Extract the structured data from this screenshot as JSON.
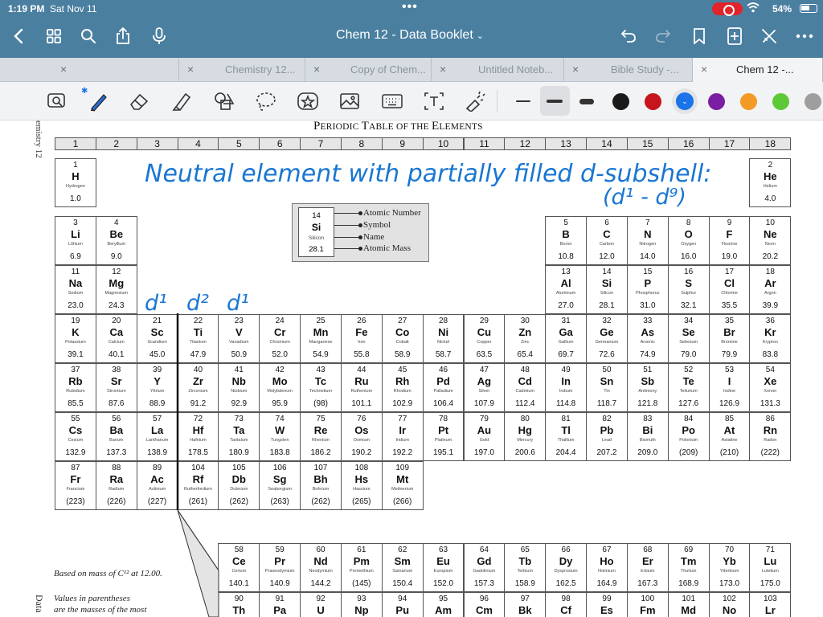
{
  "status": {
    "time": "1:19 PM",
    "date": "Sat Nov 11",
    "battery": "54%"
  },
  "header": {
    "title": "Chem 12 - Data Booklet"
  },
  "tabs": [
    {
      "label": "",
      "active": false
    },
    {
      "label": "Chemistry 12...",
      "active": false
    },
    {
      "label": "Copy of Chem...",
      "active": false
    },
    {
      "label": "Untitled Noteb...",
      "active": false
    },
    {
      "label": "Bible Study -...",
      "active": false
    },
    {
      "label": "Chem 12 -...",
      "active": true
    }
  ],
  "toolbar": {
    "tools": [
      "lasso-zoom-icon",
      "pen-icon",
      "eraser-icon",
      "highlighter-icon",
      "shapes-icon",
      "lasso-icon",
      "sticker-icon",
      "image-icon",
      "keyboard-icon",
      "text-icon",
      "laser-pointer-icon"
    ],
    "colors": [
      "#1a1a1a",
      "#c8141c",
      "#1a73e8",
      "#7b1fa2",
      "#f39a26",
      "#5ec936",
      "#9e9e9e"
    ],
    "selected_color": "#1a73e8"
  },
  "page": {
    "side_top": "emistry 12",
    "side_bottom": "Data",
    "title_first": "P",
    "title_rest": "ERIODIC ",
    "title_t": "T",
    "title_able": "ABLE OF THE ",
    "title_e": "E",
    "title_lements": "LEMENTS",
    "footnote_1": "Based on mass of C¹² at 12.00.",
    "footnote_2": "Values in parentheses",
    "footnote_3": "are the masses of the most"
  },
  "groups": [
    "1",
    "2",
    "3",
    "4",
    "5",
    "6",
    "7",
    "8",
    "9",
    "10",
    "11",
    "12",
    "13",
    "14",
    "15",
    "16",
    "17",
    "18"
  ],
  "key": {
    "n": "14",
    "s": "Si",
    "nm": "Silicon",
    "m": "28.1",
    "labels": [
      "Atomic Number",
      "Symbol",
      "Name",
      "Atomic Mass"
    ]
  },
  "ink": {
    "line1": "Neutral element with partially filled d-subshell:",
    "line2": "(d¹ - d⁹)",
    "d1a": "d¹",
    "d2": "d²",
    "d1b": "d¹"
  },
  "elements": [
    {
      "n": "1",
      "s": "H",
      "nm": "Hydrogen",
      "m": "1.0",
      "r": 0,
      "c": 0
    },
    {
      "n": "2",
      "s": "He",
      "nm": "Helium",
      "m": "4.0",
      "r": 0,
      "c": 17
    },
    {
      "n": "3",
      "s": "Li",
      "nm": "Lithium",
      "m": "6.9",
      "r": 1,
      "c": 0
    },
    {
      "n": "4",
      "s": "Be",
      "nm": "Beryllium",
      "m": "9.0",
      "r": 1,
      "c": 1
    },
    {
      "n": "5",
      "s": "B",
      "nm": "Boron",
      "m": "10.8",
      "r": 1,
      "c": 12
    },
    {
      "n": "6",
      "s": "C",
      "nm": "Carbon",
      "m": "12.0",
      "r": 1,
      "c": 13
    },
    {
      "n": "7",
      "s": "N",
      "nm": "Nitrogen",
      "m": "14.0",
      "r": 1,
      "c": 14
    },
    {
      "n": "8",
      "s": "O",
      "nm": "Oxygen",
      "m": "16.0",
      "r": 1,
      "c": 15
    },
    {
      "n": "9",
      "s": "F",
      "nm": "Fluorine",
      "m": "19.0",
      "r": 1,
      "c": 16
    },
    {
      "n": "10",
      "s": "Ne",
      "nm": "Neon",
      "m": "20.2",
      "r": 1,
      "c": 17
    },
    {
      "n": "11",
      "s": "Na",
      "nm": "Sodium",
      "m": "23.0",
      "r": 2,
      "c": 0
    },
    {
      "n": "12",
      "s": "Mg",
      "nm": "Magnesium",
      "m": "24.3",
      "r": 2,
      "c": 1
    },
    {
      "n": "13",
      "s": "Al",
      "nm": "Aluminum",
      "m": "27.0",
      "r": 2,
      "c": 12
    },
    {
      "n": "14",
      "s": "Si",
      "nm": "Silicon",
      "m": "28.1",
      "r": 2,
      "c": 13
    },
    {
      "n": "15",
      "s": "P",
      "nm": "Phosphorus",
      "m": "31.0",
      "r": 2,
      "c": 14
    },
    {
      "n": "16",
      "s": "S",
      "nm": "Sulphur",
      "m": "32.1",
      "r": 2,
      "c": 15
    },
    {
      "n": "17",
      "s": "Cl",
      "nm": "Chlorine",
      "m": "35.5",
      "r": 2,
      "c": 16
    },
    {
      "n": "18",
      "s": "Ar",
      "nm": "Argon",
      "m": "39.9",
      "r": 2,
      "c": 17
    },
    {
      "n": "19",
      "s": "K",
      "nm": "Potassium",
      "m": "39.1",
      "r": 3,
      "c": 0
    },
    {
      "n": "20",
      "s": "Ca",
      "nm": "Calcium",
      "m": "40.1",
      "r": 3,
      "c": 1
    },
    {
      "n": "21",
      "s": "Sc",
      "nm": "Scandium",
      "m": "45.0",
      "r": 3,
      "c": 2
    },
    {
      "n": "22",
      "s": "Ti",
      "nm": "Titanium",
      "m": "47.9",
      "r": 3,
      "c": 3
    },
    {
      "n": "23",
      "s": "V",
      "nm": "Vanadium",
      "m": "50.9",
      "r": 3,
      "c": 4
    },
    {
      "n": "24",
      "s": "Cr",
      "nm": "Chromium",
      "m": "52.0",
      "r": 3,
      "c": 5
    },
    {
      "n": "25",
      "s": "Mn",
      "nm": "Manganese",
      "m": "54.9",
      "r": 3,
      "c": 6
    },
    {
      "n": "26",
      "s": "Fe",
      "nm": "Iron",
      "m": "55.8",
      "r": 3,
      "c": 7
    },
    {
      "n": "27",
      "s": "Co",
      "nm": "Cobalt",
      "m": "58.9",
      "r": 3,
      "c": 8
    },
    {
      "n": "28",
      "s": "Ni",
      "nm": "Nickel",
      "m": "58.7",
      "r": 3,
      "c": 9
    },
    {
      "n": "29",
      "s": "Cu",
      "nm": "Copper",
      "m": "63.5",
      "r": 3,
      "c": 10
    },
    {
      "n": "30",
      "s": "Zn",
      "nm": "Zinc",
      "m": "65.4",
      "r": 3,
      "c": 11
    },
    {
      "n": "31",
      "s": "Ga",
      "nm": "Gallium",
      "m": "69.7",
      "r": 3,
      "c": 12
    },
    {
      "n": "32",
      "s": "Ge",
      "nm": "Germanium",
      "m": "72.6",
      "r": 3,
      "c": 13
    },
    {
      "n": "33",
      "s": "As",
      "nm": "Arsenic",
      "m": "74.9",
      "r": 3,
      "c": 14
    },
    {
      "n": "34",
      "s": "Se",
      "nm": "Selenium",
      "m": "79.0",
      "r": 3,
      "c": 15
    },
    {
      "n": "35",
      "s": "Br",
      "nm": "Bromine",
      "m": "79.9",
      "r": 3,
      "c": 16
    },
    {
      "n": "36",
      "s": "Kr",
      "nm": "Krypton",
      "m": "83.8",
      "r": 3,
      "c": 17
    },
    {
      "n": "37",
      "s": "Rb",
      "nm": "Rubidium",
      "m": "85.5",
      "r": 4,
      "c": 0
    },
    {
      "n": "38",
      "s": "Sr",
      "nm": "Strontium",
      "m": "87.6",
      "r": 4,
      "c": 1
    },
    {
      "n": "39",
      "s": "Y",
      "nm": "Yttrium",
      "m": "88.9",
      "r": 4,
      "c": 2
    },
    {
      "n": "40",
      "s": "Zr",
      "nm": "Zirconium",
      "m": "91.2",
      "r": 4,
      "c": 3
    },
    {
      "n": "41",
      "s": "Nb",
      "nm": "Niobium",
      "m": "92.9",
      "r": 4,
      "c": 4
    },
    {
      "n": "42",
      "s": "Mo",
      "nm": "Molybdenum",
      "m": "95.9",
      "r": 4,
      "c": 5
    },
    {
      "n": "43",
      "s": "Tc",
      "nm": "Technetium",
      "m": "(98)",
      "r": 4,
      "c": 6
    },
    {
      "n": "44",
      "s": "Ru",
      "nm": "Ruthenium",
      "m": "101.1",
      "r": 4,
      "c": 7
    },
    {
      "n": "45",
      "s": "Rh",
      "nm": "Rhodium",
      "m": "102.9",
      "r": 4,
      "c": 8
    },
    {
      "n": "46",
      "s": "Pd",
      "nm": "Palladium",
      "m": "106.4",
      "r": 4,
      "c": 9
    },
    {
      "n": "47",
      "s": "Ag",
      "nm": "Silver",
      "m": "107.9",
      "r": 4,
      "c": 10
    },
    {
      "n": "48",
      "s": "Cd",
      "nm": "Cadmium",
      "m": "112.4",
      "r": 4,
      "c": 11
    },
    {
      "n": "49",
      "s": "In",
      "nm": "Indium",
      "m": "114.8",
      "r": 4,
      "c": 12
    },
    {
      "n": "50",
      "s": "Sn",
      "nm": "Tin",
      "m": "118.7",
      "r": 4,
      "c": 13
    },
    {
      "n": "51",
      "s": "Sb",
      "nm": "Antimony",
      "m": "121.8",
      "r": 4,
      "c": 14
    },
    {
      "n": "52",
      "s": "Te",
      "nm": "Tellurium",
      "m": "127.6",
      "r": 4,
      "c": 15
    },
    {
      "n": "53",
      "s": "I",
      "nm": "Iodine",
      "m": "126.9",
      "r": 4,
      "c": 16
    },
    {
      "n": "54",
      "s": "Xe",
      "nm": "Xenon",
      "m": "131.3",
      "r": 4,
      "c": 17
    },
    {
      "n": "55",
      "s": "Cs",
      "nm": "Cesium",
      "m": "132.9",
      "r": 5,
      "c": 0
    },
    {
      "n": "56",
      "s": "Ba",
      "nm": "Barium",
      "m": "137.3",
      "r": 5,
      "c": 1
    },
    {
      "n": "57",
      "s": "La",
      "nm": "Lanthanum",
      "m": "138.9",
      "r": 5,
      "c": 2
    },
    {
      "n": "72",
      "s": "Hf",
      "nm": "Hafnium",
      "m": "178.5",
      "r": 5,
      "c": 3
    },
    {
      "n": "73",
      "s": "Ta",
      "nm": "Tantalum",
      "m": "180.9",
      "r": 5,
      "c": 4
    },
    {
      "n": "74",
      "s": "W",
      "nm": "Tungsten",
      "m": "183.8",
      "r": 5,
      "c": 5
    },
    {
      "n": "75",
      "s": "Re",
      "nm": "Rhenium",
      "m": "186.2",
      "r": 5,
      "c": 6
    },
    {
      "n": "76",
      "s": "Os",
      "nm": "Osmium",
      "m": "190.2",
      "r": 5,
      "c": 7
    },
    {
      "n": "77",
      "s": "Ir",
      "nm": "Iridium",
      "m": "192.2",
      "r": 5,
      "c": 8
    },
    {
      "n": "78",
      "s": "Pt",
      "nm": "Platinum",
      "m": "195.1",
      "r": 5,
      "c": 9
    },
    {
      "n": "79",
      "s": "Au",
      "nm": "Gold",
      "m": "197.0",
      "r": 5,
      "c": 10
    },
    {
      "n": "80",
      "s": "Hg",
      "nm": "Mercury",
      "m": "200.6",
      "r": 5,
      "c": 11
    },
    {
      "n": "81",
      "s": "Tl",
      "nm": "Thallium",
      "m": "204.4",
      "r": 5,
      "c": 12
    },
    {
      "n": "82",
      "s": "Pb",
      "nm": "Lead",
      "m": "207.2",
      "r": 5,
      "c": 13
    },
    {
      "n": "83",
      "s": "Bi",
      "nm": "Bismuth",
      "m": "209.0",
      "r": 5,
      "c": 14
    },
    {
      "n": "84",
      "s": "Po",
      "nm": "Polonium",
      "m": "(209)",
      "r": 5,
      "c": 15
    },
    {
      "n": "85",
      "s": "At",
      "nm": "Astatine",
      "m": "(210)",
      "r": 5,
      "c": 16
    },
    {
      "n": "86",
      "s": "Rn",
      "nm": "Radon",
      "m": "(222)",
      "r": 5,
      "c": 17
    },
    {
      "n": "87",
      "s": "Fr",
      "nm": "Francium",
      "m": "(223)",
      "r": 6,
      "c": 0
    },
    {
      "n": "88",
      "s": "Ra",
      "nm": "Radium",
      "m": "(226)",
      "r": 6,
      "c": 1
    },
    {
      "n": "89",
      "s": "Ac",
      "nm": "Actinium",
      "m": "(227)",
      "r": 6,
      "c": 2
    },
    {
      "n": "104",
      "s": "Rf",
      "nm": "Rutherfordium",
      "m": "(261)",
      "r": 6,
      "c": 3
    },
    {
      "n": "105",
      "s": "Db",
      "nm": "Dubnium",
      "m": "(262)",
      "r": 6,
      "c": 4
    },
    {
      "n": "106",
      "s": "Sg",
      "nm": "Seaborgium",
      "m": "(263)",
      "r": 6,
      "c": 5
    },
    {
      "n": "107",
      "s": "Bh",
      "nm": "Bohrium",
      "m": "(262)",
      "r": 6,
      "c": 6
    },
    {
      "n": "108",
      "s": "Hs",
      "nm": "Hassium",
      "m": "(265)",
      "r": 6,
      "c": 7
    },
    {
      "n": "109",
      "s": "Mt",
      "nm": "Meitnerium",
      "m": "(266)",
      "r": 6,
      "c": 8
    },
    {
      "n": "58",
      "s": "Ce",
      "nm": "Cerium",
      "m": "140.1",
      "r": 7,
      "c": 4
    },
    {
      "n": "59",
      "s": "Pr",
      "nm": "Praseodymium",
      "m": "140.9",
      "r": 7,
      "c": 5
    },
    {
      "n": "60",
      "s": "Nd",
      "nm": "Neodymium",
      "m": "144.2",
      "r": 7,
      "c": 6
    },
    {
      "n": "61",
      "s": "Pm",
      "nm": "Promethium",
      "m": "(145)",
      "r": 7,
      "c": 7
    },
    {
      "n": "62",
      "s": "Sm",
      "nm": "Samarium",
      "m": "150.4",
      "r": 7,
      "c": 8
    },
    {
      "n": "63",
      "s": "Eu",
      "nm": "Europium",
      "m": "152.0",
      "r": 7,
      "c": 9
    },
    {
      "n": "64",
      "s": "Gd",
      "nm": "Gadolinium",
      "m": "157.3",
      "r": 7,
      "c": 10
    },
    {
      "n": "65",
      "s": "Tb",
      "nm": "Terbium",
      "m": "158.9",
      "r": 7,
      "c": 11
    },
    {
      "n": "66",
      "s": "Dy",
      "nm": "Dysprosium",
      "m": "162.5",
      "r": 7,
      "c": 12
    },
    {
      "n": "67",
      "s": "Ho",
      "nm": "Holmium",
      "m": "164.9",
      "r": 7,
      "c": 13
    },
    {
      "n": "68",
      "s": "Er",
      "nm": "Erbium",
      "m": "167.3",
      "r": 7,
      "c": 14
    },
    {
      "n": "69",
      "s": "Tm",
      "nm": "Thulium",
      "m": "168.9",
      "r": 7,
      "c": 15
    },
    {
      "n": "70",
      "s": "Yb",
      "nm": "Ytterbium",
      "m": "173.0",
      "r": 7,
      "c": 16
    },
    {
      "n": "71",
      "s": "Lu",
      "nm": "Lutetium",
      "m": "175.0",
      "r": 7,
      "c": 17
    },
    {
      "n": "90",
      "s": "Th",
      "nm": "",
      "m": "",
      "r": 8,
      "c": 4
    },
    {
      "n": "91",
      "s": "Pa",
      "nm": "",
      "m": "",
      "r": 8,
      "c": 5
    },
    {
      "n": "92",
      "s": "U",
      "nm": "",
      "m": "",
      "r": 8,
      "c": 6
    },
    {
      "n": "93",
      "s": "Np",
      "nm": "",
      "m": "",
      "r": 8,
      "c": 7
    },
    {
      "n": "94",
      "s": "Pu",
      "nm": "",
      "m": "",
      "r": 8,
      "c": 8
    },
    {
      "n": "95",
      "s": "Am",
      "nm": "",
      "m": "",
      "r": 8,
      "c": 9
    },
    {
      "n": "96",
      "s": "Cm",
      "nm": "",
      "m": "",
      "r": 8,
      "c": 10
    },
    {
      "n": "97",
      "s": "Bk",
      "nm": "",
      "m": "",
      "r": 8,
      "c": 11
    },
    {
      "n": "98",
      "s": "Cf",
      "nm": "",
      "m": "",
      "r": 8,
      "c": 12
    },
    {
      "n": "99",
      "s": "Es",
      "nm": "",
      "m": "",
      "r": 8,
      "c": 13
    },
    {
      "n": "100",
      "s": "Fm",
      "nm": "",
      "m": "",
      "r": 8,
      "c": 14
    },
    {
      "n": "101",
      "s": "Md",
      "nm": "",
      "m": "",
      "r": 8,
      "c": 15
    },
    {
      "n": "102",
      "s": "No",
      "nm": "",
      "m": "",
      "r": 8,
      "c": 16
    },
    {
      "n": "103",
      "s": "Lr",
      "nm": "",
      "m": "",
      "r": 8,
      "c": 17
    }
  ]
}
